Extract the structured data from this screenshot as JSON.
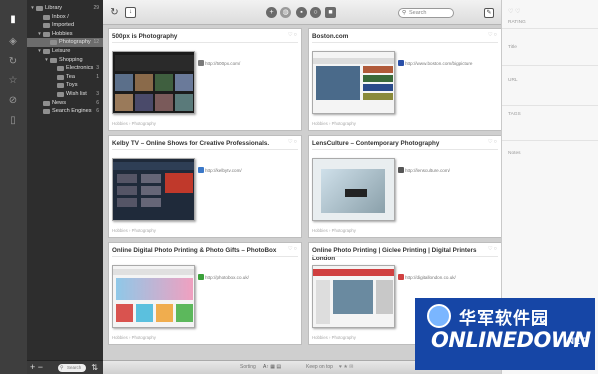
{
  "sidebar": {
    "tree": [
      {
        "label": "Library",
        "count": "29",
        "depth": 0,
        "expanded": true,
        "selected": false
      },
      {
        "label": "Inbox /",
        "count": "",
        "depth": 1,
        "expanded": false,
        "selected": false
      },
      {
        "label": "Imported",
        "count": "",
        "depth": 1,
        "expanded": false,
        "selected": false
      },
      {
        "label": "Hobbies",
        "count": "",
        "depth": 1,
        "expanded": true,
        "selected": false
      },
      {
        "label": "Photography",
        "count": "12",
        "depth": 2,
        "expanded": false,
        "selected": true
      },
      {
        "label": "Leisure",
        "count": "",
        "depth": 1,
        "expanded": true,
        "selected": false
      },
      {
        "label": "Shopping",
        "count": "",
        "depth": 2,
        "expanded": true,
        "selected": false
      },
      {
        "label": "Electronics",
        "count": "3",
        "depth": 3,
        "expanded": false,
        "selected": false
      },
      {
        "label": "Tea",
        "count": "1",
        "depth": 3,
        "expanded": false,
        "selected": false
      },
      {
        "label": "Toys",
        "count": "",
        "depth": 3,
        "expanded": false,
        "selected": false
      },
      {
        "label": "Wish list",
        "count": "3",
        "depth": 3,
        "expanded": false,
        "selected": false
      },
      {
        "label": "News",
        "count": "6",
        "depth": 1,
        "expanded": false,
        "selected": false
      },
      {
        "label": "Search Engines",
        "count": "6",
        "depth": 1,
        "expanded": false,
        "selected": false
      }
    ],
    "search_placeholder": "Search"
  },
  "toolbar": {
    "search_placeholder": "Search"
  },
  "cards": [
    {
      "title": "500px is Photography",
      "url": "http://500px.com/",
      "folder": "Hobbies › Photography",
      "favicon_color": "#7a7a7a"
    },
    {
      "title": "Boston.com",
      "url": "http://www.boston.com/bigpicture",
      "folder": "Hobbies › Photography",
      "favicon_color": "#2a4fa8"
    },
    {
      "title": "Kelby TV – Online Shows for Creative Professionals.",
      "url": "http://kelbytv.com/",
      "folder": "Hobbies › Photography",
      "favicon_color": "#3a78c8"
    },
    {
      "title": "LensCulture – Contemporary Photography",
      "url": "http://lensculture.com/",
      "folder": "Hobbies › Photography",
      "favicon_color": "#555555"
    },
    {
      "title": "Online Digital Photo Printing & Photo Gifts – PhotoBox",
      "url": "http://photobox.co.uk/",
      "folder": "Hobbies › Photography",
      "favicon_color": "#3aa03a"
    },
    {
      "title": "Online Photo Printing | Giclee Printing | Digital Printers London",
      "url": "http://digitallondon.co.uk/",
      "folder": "Hobbies › Photography",
      "favicon_color": "#d04040"
    }
  ],
  "bottombar": {
    "sorting_label": "Sorting",
    "keep_on_top_label": "Keep on top"
  },
  "inspector": {
    "rating_label": "RATING",
    "title_label": "Title",
    "url_label": "URL",
    "tags_label": "TAGS",
    "notes_label": "Notes"
  },
  "watermark": {
    "cn_text": "华军软件园",
    "en_text": "ONLINEDOWN",
    "net_text": ".NET"
  },
  "colors": {
    "rail": "#3e3e3e",
    "sidebar": "#2d2d2d",
    "selection": "#6c6c6c",
    "watermark_blue": "#1646a6"
  }
}
